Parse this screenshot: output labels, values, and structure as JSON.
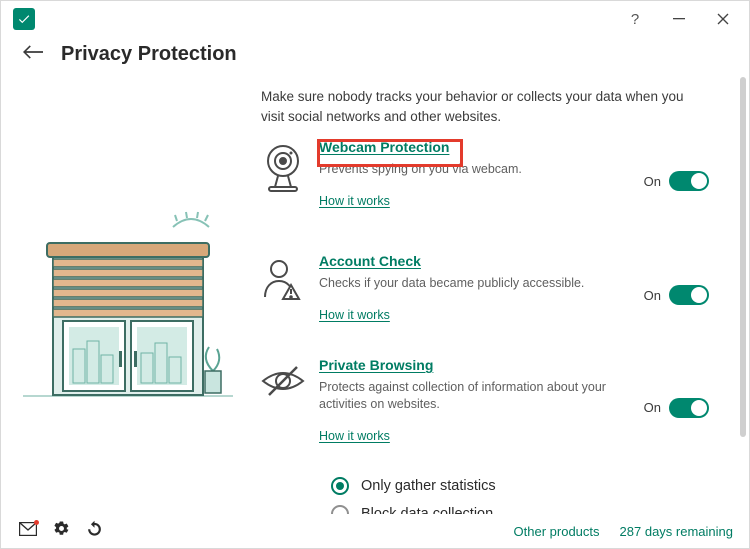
{
  "header": {
    "title": "Privacy Protection"
  },
  "intro": "Make sure nobody tracks your behavior or collects your data when you visit social networks and other websites.",
  "features": {
    "webcam": {
      "title": "Webcam Protection",
      "desc": "Prevents spying on you via webcam.",
      "how": "How it works",
      "state": "On"
    },
    "account": {
      "title": "Account Check",
      "desc": "Checks if your data became publicly accessible.",
      "how": "How it works",
      "state": "On"
    },
    "private": {
      "title": "Private Browsing",
      "desc": "Protects against collection of information about your activities on websites.",
      "how": "How it works",
      "state": "On"
    }
  },
  "radios": {
    "opt1": "Only gather statistics",
    "opt2": "Block data collection"
  },
  "footer": {
    "other": "Other products",
    "days": "287 days remaining"
  }
}
